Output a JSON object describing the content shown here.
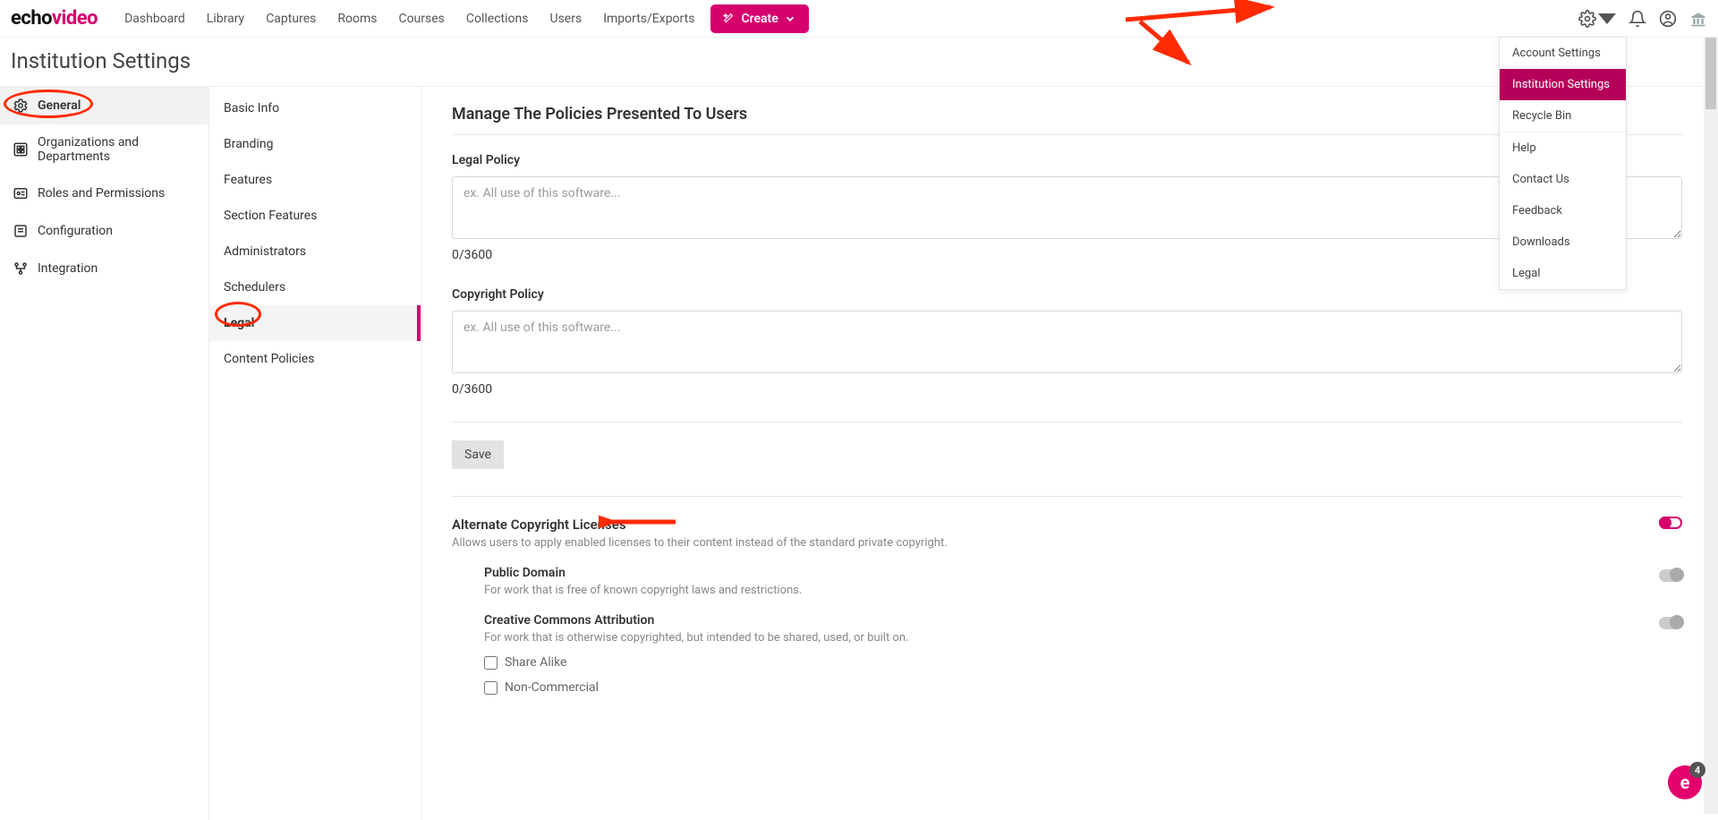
{
  "brand": {
    "part1": "echo",
    "part2": "video"
  },
  "nav": {
    "items": [
      "Dashboard",
      "Library",
      "Captures",
      "Rooms",
      "Courses",
      "Collections",
      "Users",
      "Imports/Exports"
    ]
  },
  "create_label": "Create",
  "page_title": "Institution Settings",
  "sidebar_left": {
    "items": [
      {
        "label": "General",
        "active": true
      },
      {
        "label": "Organizations and Departments"
      },
      {
        "label": "Roles and Permissions"
      },
      {
        "label": "Configuration"
      },
      {
        "label": "Integration"
      }
    ]
  },
  "sidebar_mid": {
    "items": [
      "Basic Info",
      "Branding",
      "Features",
      "Section Features",
      "Administrators",
      "Schedulers",
      "Legal",
      "Content Policies"
    ],
    "active_index": 6
  },
  "main": {
    "heading": "Manage The Policies Presented To Users",
    "legal": {
      "label": "Legal Policy",
      "placeholder": "ex. All use of this software...",
      "counter": "0/3600"
    },
    "copyright": {
      "label": "Copyright Policy",
      "placeholder": "ex. All use of this software...",
      "counter": "0/3600"
    },
    "save": "Save",
    "alt_licenses": {
      "title": "Alternate Copyright Licenses",
      "desc": "Allows users to apply enabled licenses to their content instead of the standard private copyright.",
      "toggle_on": true,
      "items": [
        {
          "title": "Public Domain",
          "desc": "For work that is free of known copyright laws and restrictions.",
          "on": false
        },
        {
          "title": "Creative Commons Attribution",
          "desc": "For work that is otherwise copyrighted, but intended to be shared, used, or built on.",
          "on": false,
          "checks": [
            {
              "label": "Share Alike",
              "checked": false
            },
            {
              "label": "Non-Commercial",
              "checked": false
            }
          ]
        }
      ]
    }
  },
  "dropdown": {
    "items": [
      "Account Settings",
      "Institution Settings",
      "Recycle Bin",
      "Help",
      "Contact Us",
      "Feedback",
      "Downloads",
      "Legal"
    ],
    "selected_index": 1,
    "sep_after_index": 2
  },
  "fab": {
    "letter": "e",
    "badge": "4"
  }
}
